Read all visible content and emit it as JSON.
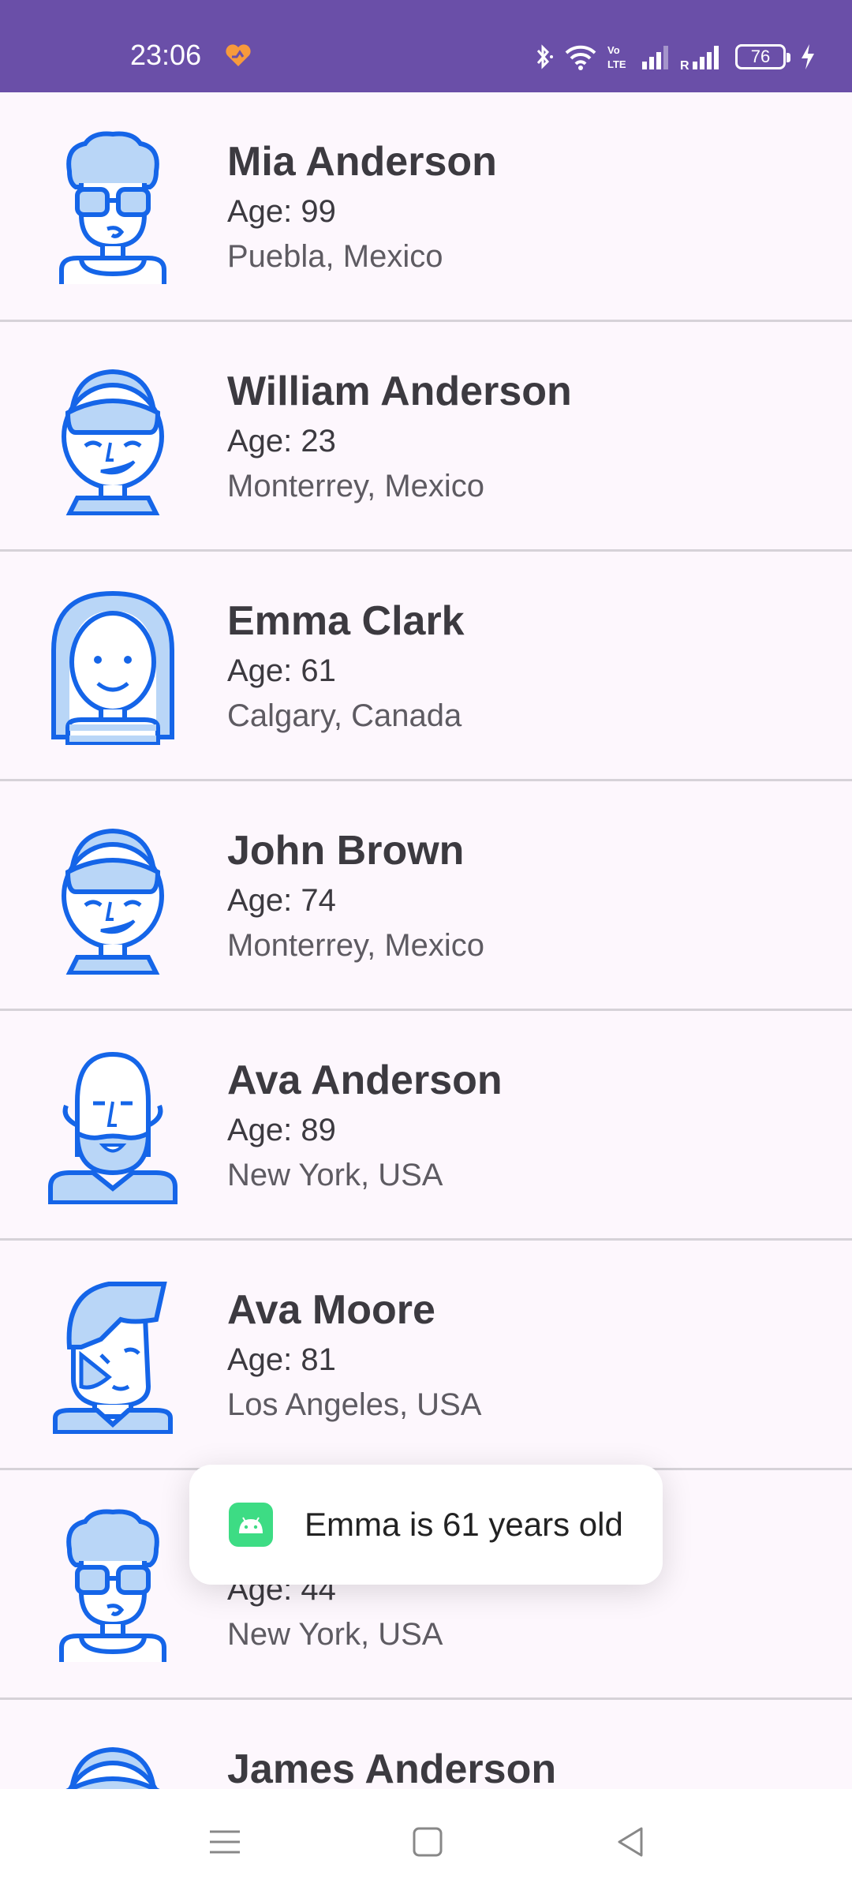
{
  "status_bar": {
    "time": "23:06",
    "battery_level": "76",
    "icons": [
      "heart-app-icon",
      "bluetooth-icon",
      "wifi-icon",
      "volte-icon",
      "signal-icon",
      "roaming-signal-icon",
      "battery-icon",
      "charging-icon"
    ],
    "roaming_label": "R",
    "volte_label": "Vo LTE"
  },
  "contacts": [
    {
      "name": "Mia Anderson",
      "age": "Age: 99",
      "city": "Puebla, Mexico",
      "avatar": "curly-glasses"
    },
    {
      "name": "William Anderson",
      "age": "Age: 23",
      "city": "Monterrey, Mexico",
      "avatar": "smiling-cap"
    },
    {
      "name": "Emma Clark",
      "age": "Age: 61",
      "city": "Calgary, Canada",
      "avatar": "long-hair-woman"
    },
    {
      "name": "John Brown",
      "age": "Age: 74",
      "city": "Monterrey, Mexico",
      "avatar": "smiling-cap"
    },
    {
      "name": "Ava Anderson",
      "age": "Age: 89",
      "city": "New York, USA",
      "avatar": "bald-beard"
    },
    {
      "name": "Ava Moore",
      "age": "Age: 81",
      "city": "Los Angeles, USA",
      "avatar": "quiff"
    },
    {
      "name": "",
      "age": "Age: 44",
      "city": "New York, USA",
      "avatar": "curly-glasses"
    },
    {
      "name": "James Anderson",
      "age": "",
      "city": "",
      "avatar": "smiling-cap"
    }
  ],
  "toast": {
    "message": "Emma is 61 years old",
    "icon": "android-app-icon"
  },
  "colors": {
    "status_bar": "#6a4fa8",
    "background": "#fdf7fd",
    "avatar_stroke": "#1565e8",
    "avatar_fill": "#b9d6f7"
  },
  "nav_bar": {
    "buttons": [
      "menu-button",
      "home-button",
      "back-button"
    ]
  }
}
